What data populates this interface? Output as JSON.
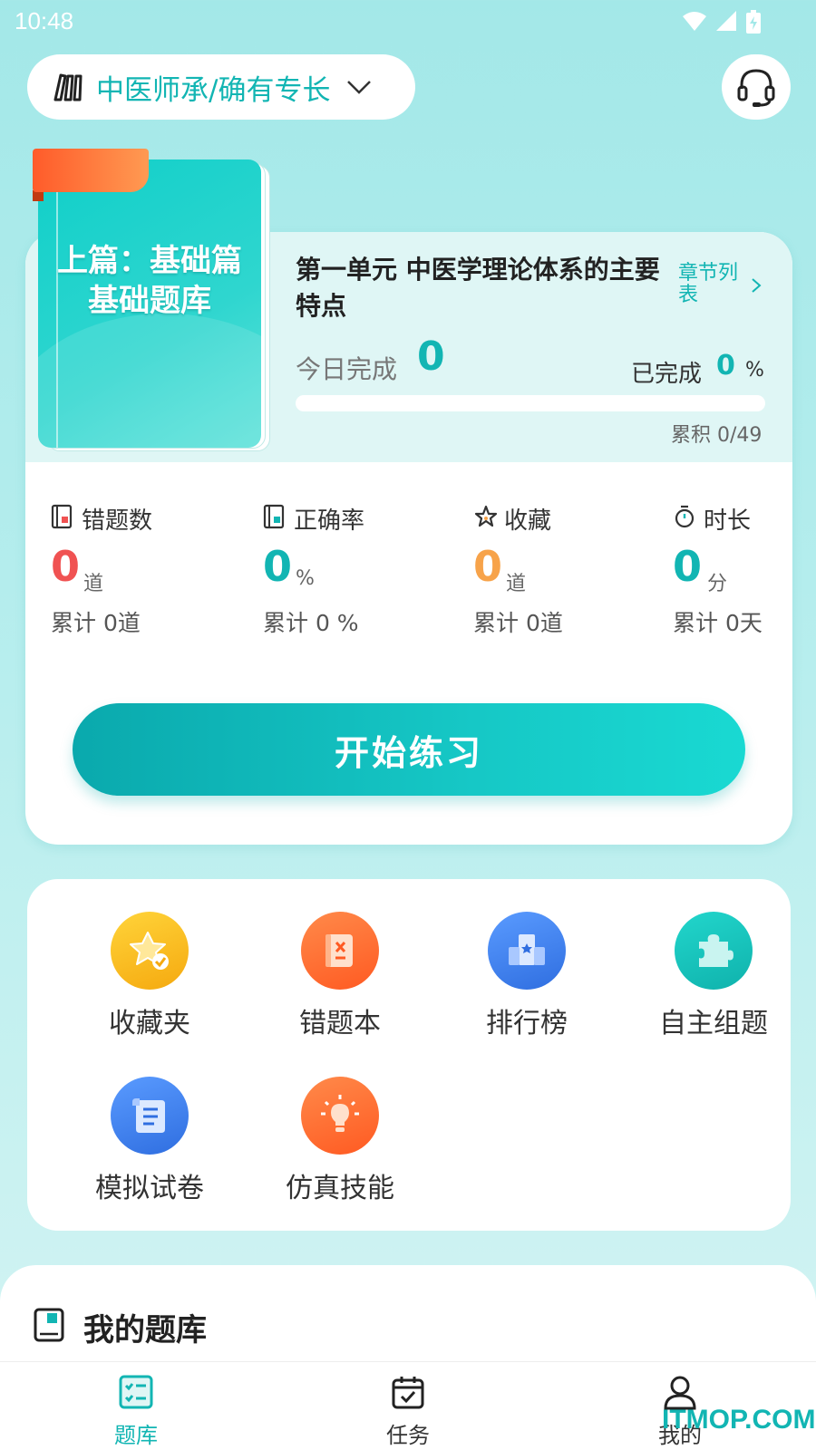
{
  "status": {
    "time": "10:48"
  },
  "header": {
    "selector_label": "中医师承/确有专长"
  },
  "book": {
    "title_line1": "上篇：基础篇",
    "title_line2": "基础题库"
  },
  "unit": {
    "title": "第一单元 中医学理论体系的主要特点",
    "chapter_list": "章节列表",
    "today_label": "今日完成",
    "today_value": "0",
    "done_label": "已完成",
    "done_value": "0",
    "done_unit": "%",
    "progress": 0,
    "accum": "累积 0/49"
  },
  "stats": [
    {
      "label": "错题数",
      "value": "0",
      "unit": "道",
      "total": "累计 0道",
      "color": "#f05252"
    },
    {
      "label": "正确率",
      "value": "0",
      "unit": "%",
      "total": "累计 0 %",
      "color": "#12b5b3"
    },
    {
      "label": "收藏",
      "value": "0",
      "unit": "道",
      "total": "累计 0道",
      "color": "#f7a34a"
    },
    {
      "label": "时长",
      "value": "0",
      "unit": "分",
      "total": "累计 0天",
      "color": "#12b5b3"
    }
  ],
  "start_button": "开始练习",
  "tools": [
    {
      "label": "收藏夹",
      "icon": "favorites-star-icon",
      "color": "#f7b719"
    },
    {
      "label": "错题本",
      "icon": "wrong-book-icon",
      "color": "#ff6a2b"
    },
    {
      "label": "排行榜",
      "icon": "ranking-podium-icon",
      "color": "#3f83f1"
    },
    {
      "label": "自主组题",
      "icon": "puzzle-icon",
      "color": "#12c1ba"
    },
    {
      "label": "模拟试卷",
      "icon": "exam-scroll-icon",
      "color": "#3f83f1"
    },
    {
      "label": "仿真技能",
      "icon": "lightbulb-icon",
      "color": "#ff6a2b"
    }
  ],
  "mybank": {
    "title": "我的题库"
  },
  "tabs": [
    {
      "label": "题库",
      "active": true
    },
    {
      "label": "任务",
      "active": false
    },
    {
      "label": "我的",
      "active": false
    }
  ],
  "watermark": "ITMOP.COM"
}
